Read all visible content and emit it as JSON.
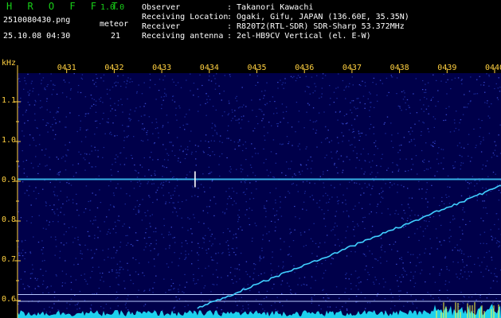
{
  "header": {
    "brand": "H R O F F T",
    "version": "1.0.0",
    "filename": "2510080430.png",
    "datetime": "25.10.08 04:30",
    "meteor_label": "meteor",
    "meteor_count": "21"
  },
  "info": [
    {
      "key": "Observer",
      "value": ": Takanori Kawachi"
    },
    {
      "key": "Receiving Location",
      "value": ": Ogaki, Gifu, JAPAN (136.60E, 35.35N)"
    },
    {
      "key": "Receiver",
      "value": ": R820T2(RTL-SDR) SDR-Sharp 53.372MHz"
    },
    {
      "key": "Receiving antenna",
      "value": ": 2el-HB9CV Vertical (el. E-W)"
    }
  ],
  "chart_data": {
    "type": "heatmap",
    "ylabel": "kHz",
    "y_ticks": [
      "1.1",
      "1.0",
      "0.9",
      "0.8",
      "0.7",
      "0.6"
    ],
    "x_ticks": [
      "0431",
      "0432",
      "0433",
      "0434",
      "0435",
      "0436",
      "0437",
      "0438",
      "0439",
      "0440"
    ],
    "xlim": [
      "0430",
      "0440"
    ],
    "ylim": [
      0.58,
      1.17
    ],
    "signals": [
      {
        "kind": "carrier",
        "freq_khz": 0.905,
        "from": "0430",
        "to": "0440"
      },
      {
        "kind": "sweep",
        "from_time": "0434",
        "from_khz": 0.58,
        "to_time": "0440",
        "to_khz": 0.89
      },
      {
        "kind": "burst",
        "time": "0433.7",
        "freq_khz": 0.905
      }
    ],
    "reference_lines_khz": [
      0.615,
      0.598
    ],
    "colors": {
      "background": "#00004a",
      "noise": "#1a2a9a",
      "signal": "#40d0ff",
      "ticks": "#ffd040",
      "bottom_trace": "#20e8ff",
      "bottom_trace_peaks": "#ffff40"
    }
  }
}
